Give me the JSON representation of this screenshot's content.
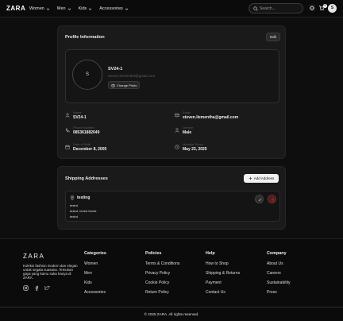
{
  "nav": {
    "logo": "ZARA",
    "menu": [
      {
        "label": "Women"
      },
      {
        "label": "Men"
      },
      {
        "label": "Kids"
      },
      {
        "label": "Accessories"
      }
    ],
    "search_placeholder": "Search...",
    "cart_count": "0",
    "avatar_initial": "S",
    "icons": [
      "search-icon",
      "sun-icon",
      "cart-icon",
      "chevron-down-icon"
    ]
  },
  "profile": {
    "title": "Profile Information",
    "edit_label": "Edit",
    "avatar_initial": "S",
    "name": "SV24-1",
    "email": "steven.liementha@gmail.com",
    "change_photo_label": "Change Photo",
    "fields": [
      {
        "label": "Name",
        "value": "SV24-1",
        "icon": "user-icon"
      },
      {
        "label": "Email",
        "value": "steven.liementha@gmail.com",
        "icon": "mail-icon"
      },
      {
        "label": "Phone Number",
        "value": "085361882049",
        "icon": "phone-icon"
      },
      {
        "label": "Gender",
        "value": "Male",
        "icon": "user-icon"
      },
      {
        "label": "Date of Birth",
        "value": "December 8, 2005",
        "icon": "calendar-icon"
      },
      {
        "label": "Member Since",
        "value": "May 23, 2025",
        "icon": "clock-icon"
      }
    ]
  },
  "shipping": {
    "title": "Shipping Addresses",
    "add_label": "Add Address",
    "addresses": [
      {
        "name": "testing",
        "lines": [
          "testrd",
          "testrd, testrd testrd",
          "testrd"
        ]
      }
    ]
  },
  "footer": {
    "logo": "ZARA",
    "tagline": "Koleksi fashion modern dan elegan untuk segala suasana. Temukan gaya yang kamu suka hanya di ZARA.",
    "socials": [
      "instagram-icon",
      "facebook-icon",
      "twitter-icon"
    ],
    "columns": [
      {
        "heading": "Categories",
        "links": [
          "Women",
          "Men",
          "Kids",
          "Accessories"
        ]
      },
      {
        "heading": "Policies",
        "links": [
          "Terms & Conditions",
          "Privacy Policy",
          "Cookie Policy",
          "Return Policy"
        ]
      },
      {
        "heading": "Help",
        "links": [
          "How to Shop",
          "Shipping & Returns",
          "Payment",
          "Contact Us"
        ]
      },
      {
        "heading": "Company",
        "links": [
          "About Us",
          "Careers",
          "Sustainability",
          "Press"
        ]
      }
    ],
    "copyright": "© 2025 ZARA. All rights reserved."
  },
  "colors": {
    "background": "#0e0e0e",
    "card": "#1a1a1a",
    "accent_danger": "#e03131"
  }
}
